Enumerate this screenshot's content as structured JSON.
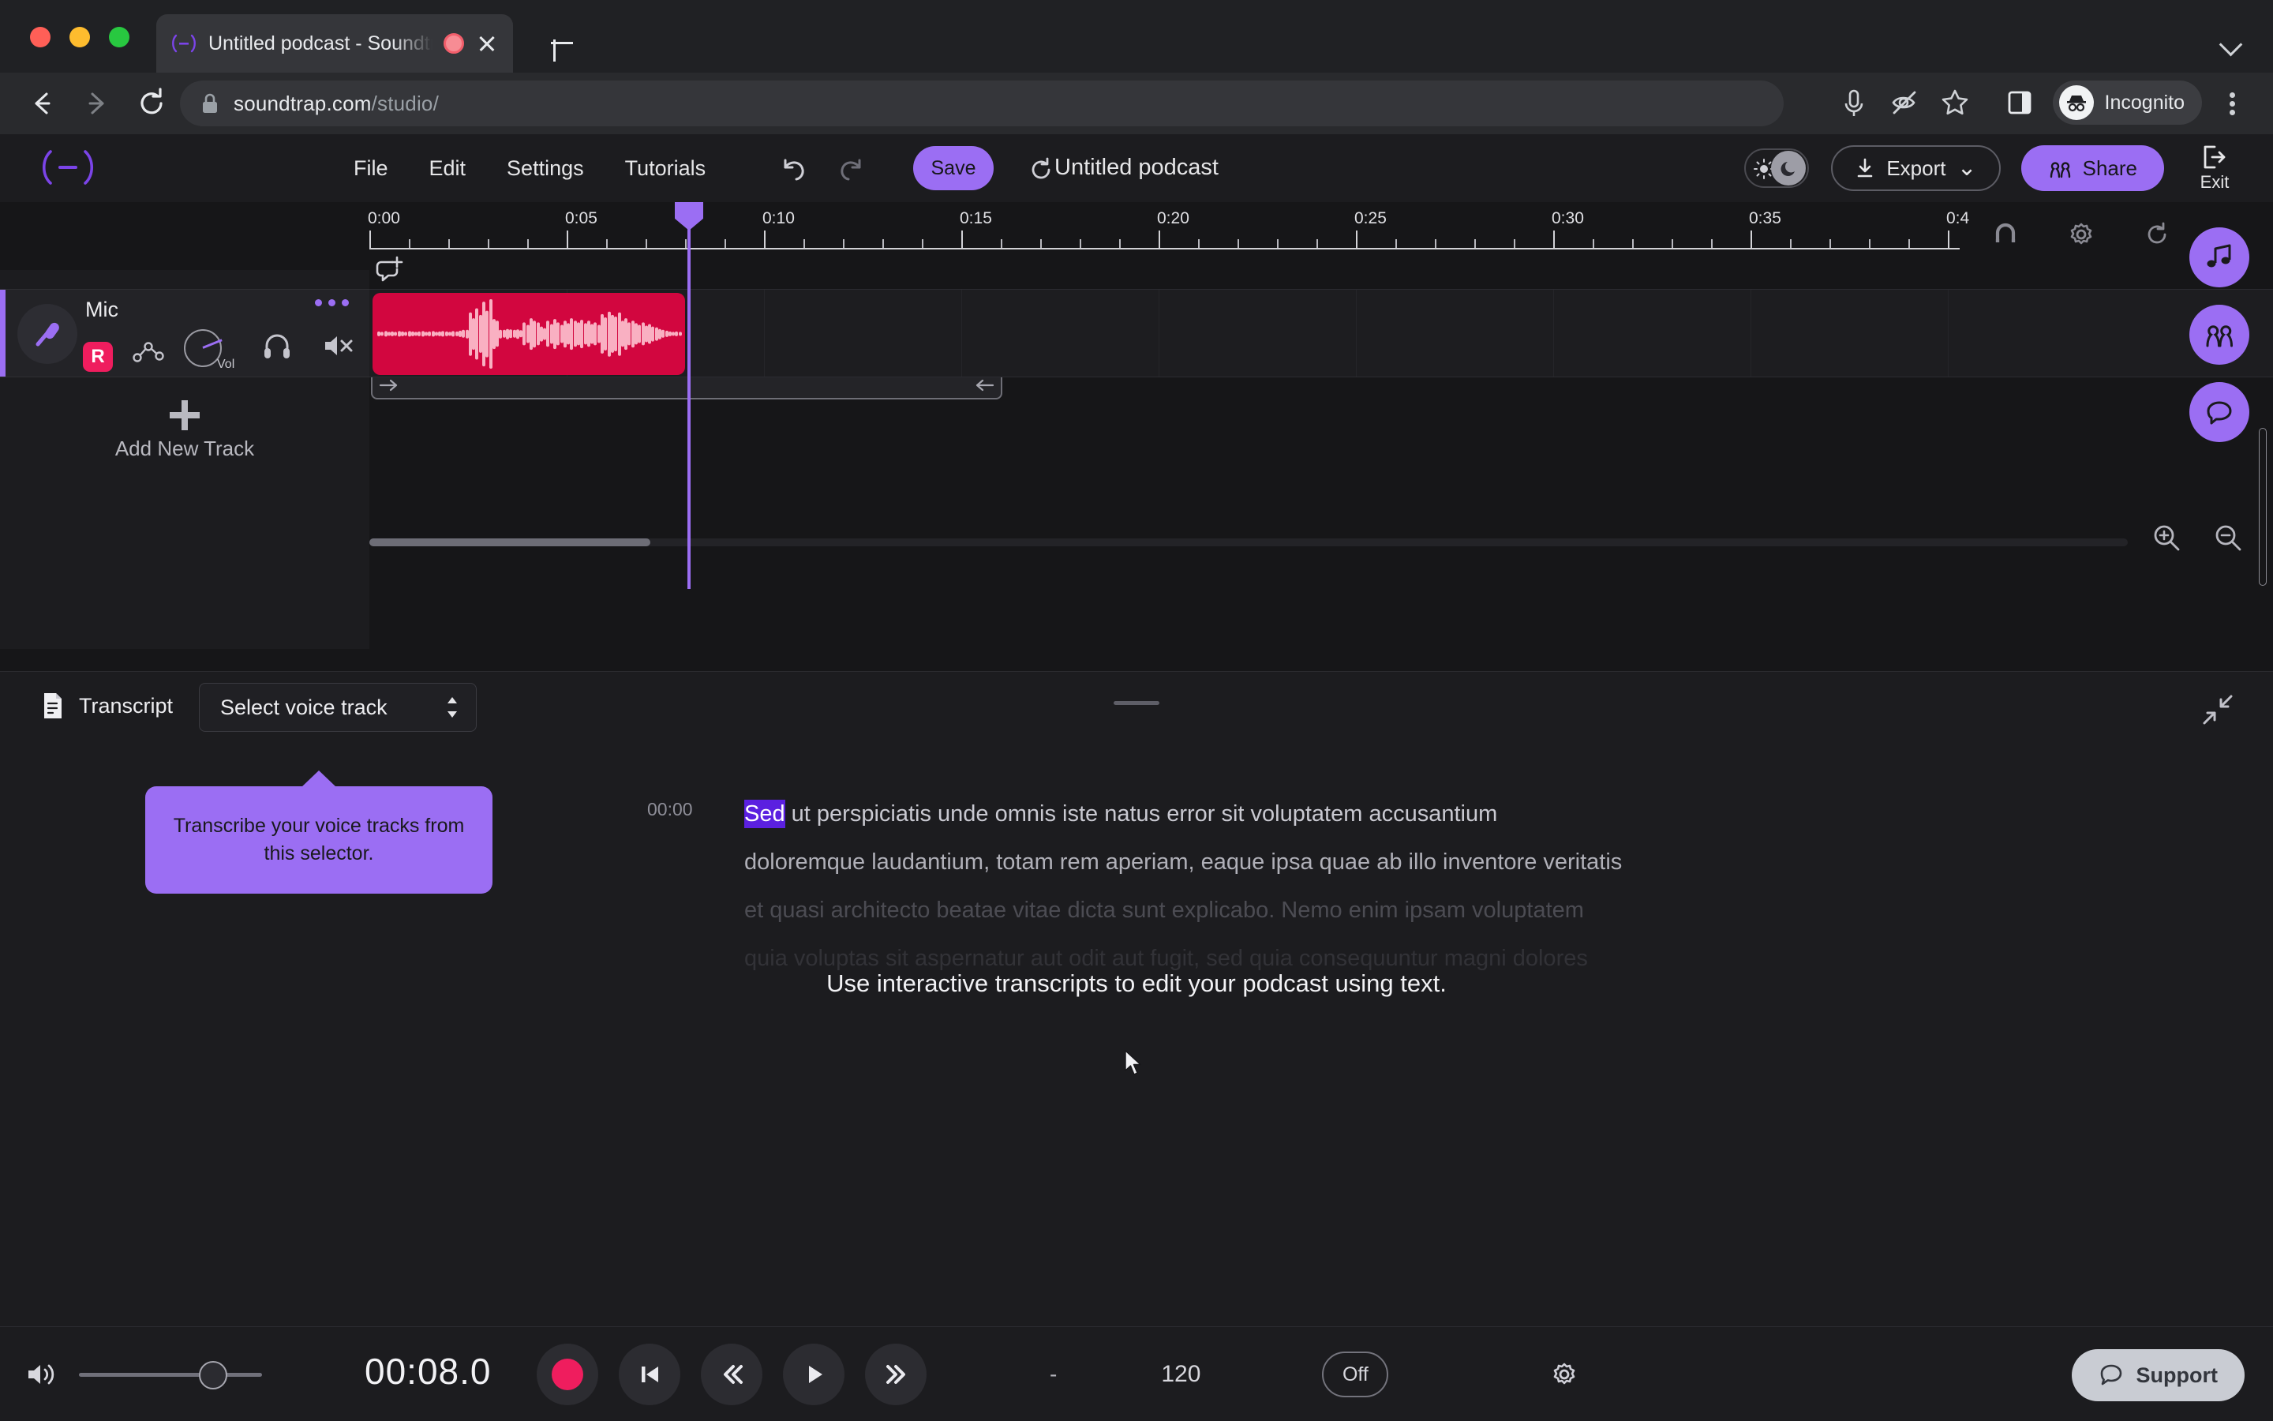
{
  "browser": {
    "tab": {
      "title": "Untitled podcast - Soundtr",
      "recording_indicator": "recording-dot",
      "close_label": "x"
    },
    "url_host": "soundtrap.com",
    "url_path": "/studio/",
    "profile_label": "Incognito",
    "new_tab_label": "+"
  },
  "appbar": {
    "menu": [
      {
        "label": "File"
      },
      {
        "label": "Edit"
      },
      {
        "label": "Settings"
      },
      {
        "label": "Tutorials"
      }
    ],
    "save_label": "Save",
    "project_title": "Untitled podcast",
    "export_label": "Export",
    "export_caret": "⌄",
    "share_label": "Share",
    "exit_label": "Exit"
  },
  "timeline": {
    "ticks": [
      {
        "label": "0:00"
      },
      {
        "label": "0:05"
      },
      {
        "label": "0:10"
      },
      {
        "label": "0:15"
      },
      {
        "label": "0:20"
      },
      {
        "label": "0:25"
      },
      {
        "label": "0:30"
      },
      {
        "label": "0:35"
      },
      {
        "label": "0:4"
      }
    ],
    "playhead_time": "0:08.0"
  },
  "track": {
    "name": "Mic",
    "record_arm_label": "R",
    "volume_label": "Vol",
    "add_new_track_label": "Add New Track"
  },
  "transcript": {
    "panel_label": "Transcript",
    "voice_track_selector": "Select voice track",
    "tooltip": "Transcribe your voice tracks from this selector.",
    "overlay_message": "Use interactive transcripts to edit your podcast using text.",
    "lines": [
      {
        "time": "00:00",
        "selected": "Sed",
        "rest": " ut perspiciatis unde omnis iste natus error sit voluptatem accusantium"
      },
      {
        "time": "",
        "selected": "",
        "rest": "doloremque laudantium, totam rem aperiam, eaque ipsa quae ab illo inventore veritatis"
      },
      {
        "time": "",
        "selected": "",
        "rest": "et quasi architecto beatae vitae dicta sunt explicabo. Nemo enim ipsam voluptatem"
      },
      {
        "time": "",
        "selected": "",
        "rest": "quia voluptas sit aspernatur aut odit aut fugit, sed quia consequuntur magni dolores"
      }
    ]
  },
  "transport": {
    "time": "00:08.0",
    "time_signature": "-",
    "bpm": "120",
    "metronome": "Off"
  },
  "support": {
    "label": "Support"
  },
  "colors": {
    "accent_purple": "#9b6ef3",
    "record_pink": "#ef1d5e",
    "clip_red": "#d2063f",
    "selection_purple": "#5b20e0",
    "panel_bg": "#1c1c1f",
    "app_bg": "#161618"
  }
}
